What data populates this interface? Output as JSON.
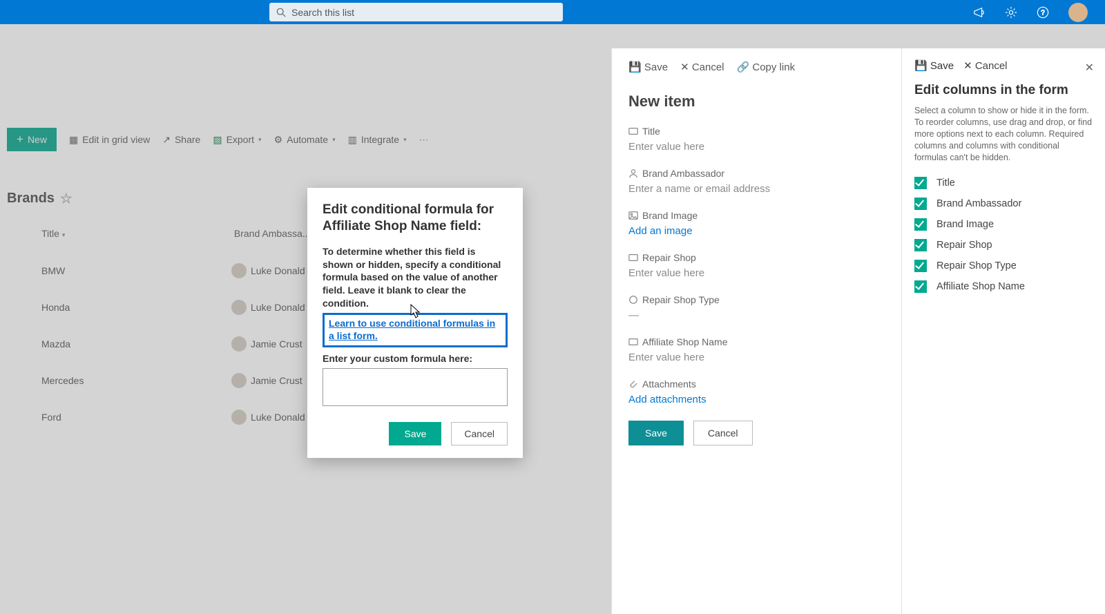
{
  "search": {
    "placeholder": "Search this list"
  },
  "toolbar": {
    "new": "New",
    "edit_grid": "Edit in grid view",
    "share": "Share",
    "export": "Export",
    "automate": "Automate",
    "integrate": "Integrate"
  },
  "list": {
    "title": "Brands",
    "columns": {
      "title": "Title",
      "ambassador": "Brand Ambassa..."
    },
    "rows": [
      {
        "title": "BMW",
        "ambassador": "Luke Donald"
      },
      {
        "title": "Honda",
        "ambassador": "Luke Donald"
      },
      {
        "title": "Mazda",
        "ambassador": "Jamie Crust"
      },
      {
        "title": "Mercedes",
        "ambassador": "Jamie Crust"
      },
      {
        "title": "Ford",
        "ambassador": "Luke Donald"
      }
    ]
  },
  "newitem": {
    "cmd": {
      "save": "Save",
      "cancel": "Cancel",
      "copylink": "Copy link"
    },
    "heading": "New item",
    "fields": {
      "title": {
        "label": "Title",
        "placeholder": "Enter value here"
      },
      "ambassador": {
        "label": "Brand Ambassador",
        "placeholder": "Enter a name or email address"
      },
      "brandimage": {
        "label": "Brand Image",
        "action": "Add an image"
      },
      "repairshop": {
        "label": "Repair Shop",
        "placeholder": "Enter value here"
      },
      "repairtype": {
        "label": "Repair Shop Type",
        "value": "—"
      },
      "affiliate": {
        "label": "Affiliate Shop Name",
        "placeholder": "Enter value here"
      },
      "attachments": {
        "label": "Attachments",
        "action": "Add attachments"
      }
    },
    "buttons": {
      "save": "Save",
      "cancel": "Cancel"
    }
  },
  "editcols": {
    "cmd": {
      "save": "Save",
      "cancel": "Cancel"
    },
    "heading": "Edit columns in the form",
    "desc": "Select a column to show or hide it in the form. To reorder columns, use drag and drop, or find more options next to each column. Required columns and columns with conditional formulas can't be hidden.",
    "items": [
      "Title",
      "Brand Ambassador",
      "Brand Image",
      "Repair Shop",
      "Repair Shop Type",
      "Affiliate Shop Name"
    ]
  },
  "modal": {
    "title": "Edit conditional formula for Affiliate Shop Name field:",
    "body": "To determine whether this field is shown or hidden, specify a conditional formula based on the value of another field. Leave it blank to clear the condition.",
    "learn": "Learn to use conditional formulas in a list form.",
    "formula_label": "Enter your custom formula here:",
    "save": "Save",
    "cancel": "Cancel"
  }
}
